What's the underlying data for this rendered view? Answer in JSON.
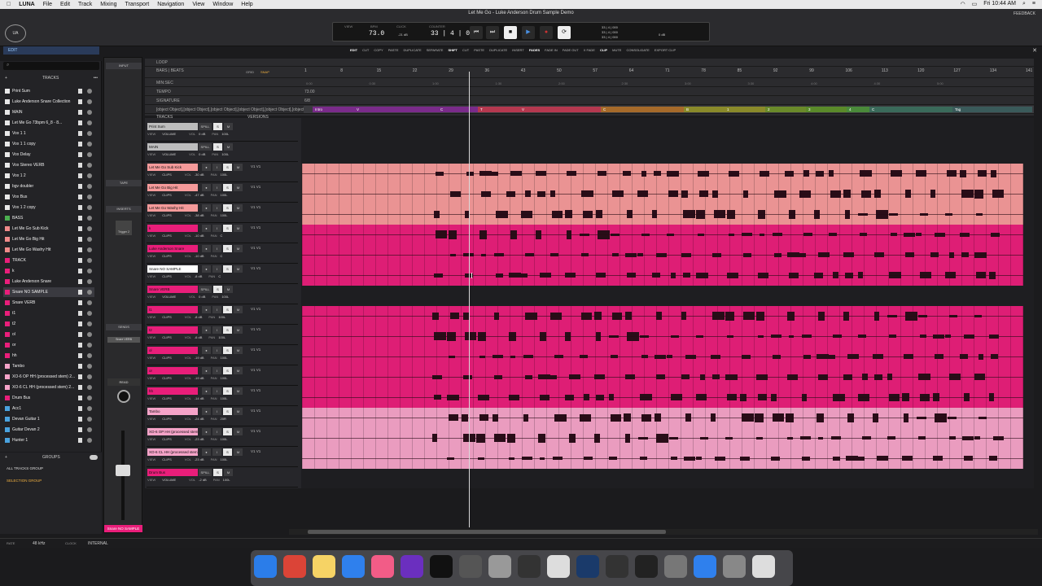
{
  "menubar": {
    "apple": "",
    "app": "LUNA",
    "items": [
      "File",
      "Edit",
      "Track",
      "Mixing",
      "Transport",
      "Navigation",
      "View",
      "Window",
      "Help"
    ],
    "time": "Fri 10:44 AM"
  },
  "window": {
    "title": "Let Me Go - Luke Anderson Drum Sample Demo",
    "feedback": "FEEDBACK"
  },
  "transport": {
    "tempo": "73.0",
    "counter": "33 | 4 | 000",
    "click_vol": "-21 dB",
    "bpm_label": "BPM",
    "click_label": "CLICK",
    "counter_label": "COUNTER",
    "view_label": "VIEW",
    "monitor": "0 dB",
    "pos1": "33 | 4 | 000",
    "pos2": "33 | 4 | 000",
    "pos3": "33 | 4 | 000"
  },
  "editbar": {
    "items": [
      "EDIT",
      "CUT",
      "COPY",
      "PASTE",
      "DUPLICATE",
      "SEPARATE",
      "SHIFT",
      "CUT",
      "PASTE",
      "DUPLICATE",
      "INSERT",
      "FADES",
      "FADE IN",
      "FADE OUT",
      "X FADE",
      "CLIP",
      "MUTE",
      "CONSOLIDATE",
      "EXPORT CLIP"
    ]
  },
  "sidebar": {
    "tab": "EDIT",
    "tracks_title": "TRACKS",
    "groups_title": "GROUPS",
    "groups": [
      "ALL TRACKS GROUP",
      "SELECTION GROUP"
    ],
    "tracks": [
      {
        "name": "Print Sum",
        "color": "#e8e8e8"
      },
      {
        "name": "Luke Anderson Snare Collection",
        "color": "#e8e8e8"
      },
      {
        "name": "MAIN",
        "color": "#e8e8e8"
      },
      {
        "name": "Let Me Go 73bpm 6_8 - 8...",
        "color": "#e8e8e8"
      },
      {
        "name": "Vox 1 1",
        "color": "#e8e8e8"
      },
      {
        "name": "Vox 1 1 copy",
        "color": "#e8e8e8"
      },
      {
        "name": "Vox Delay",
        "color": "#e8e8e8"
      },
      {
        "name": "Vox Stereo VERB",
        "color": "#e8e8e8"
      },
      {
        "name": "Vox 1 2",
        "color": "#e8e8e8"
      },
      {
        "name": "bgv doubler",
        "color": "#e8e8e8"
      },
      {
        "name": "Vox Bus",
        "color": "#e8e8e8"
      },
      {
        "name": "Vox 1 2 copy",
        "color": "#e8e8e8"
      },
      {
        "name": "BASS",
        "color": "#4caf50"
      },
      {
        "name": "Let Me Go Sub Kick",
        "color": "#f08a8a"
      },
      {
        "name": "Let Me Go Big Hit",
        "color": "#f08a8a"
      },
      {
        "name": "Let Me Go Washy Hit",
        "color": "#f08a8a"
      },
      {
        "name": "TRACK",
        "color": "#e91e7a"
      },
      {
        "name": "k",
        "color": "#e91e7a"
      },
      {
        "name": "Luke Anderson Snare",
        "color": "#e91e7a"
      },
      {
        "name": "Snare NO SAMPLE",
        "color": "#e91e7a"
      },
      {
        "name": "Snare VERB",
        "color": "#e91e7a"
      },
      {
        "name": "t1",
        "color": "#e91e7a"
      },
      {
        "name": "t2",
        "color": "#e91e7a"
      },
      {
        "name": "ol",
        "color": "#e91e7a"
      },
      {
        "name": "or",
        "color": "#e91e7a"
      },
      {
        "name": "hh",
        "color": "#e91e7a"
      },
      {
        "name": "Tambo",
        "color": "#f5a3c8"
      },
      {
        "name": "XO-6 OP HH (processed stem) 2...",
        "color": "#f5a3c8"
      },
      {
        "name": "XO-6 CL HH (processed stem) 2...",
        "color": "#f5a3c8"
      },
      {
        "name": "Drum Bus",
        "color": "#e91e7a"
      },
      {
        "name": "Acc1",
        "color": "#4aa3df"
      },
      {
        "name": "Devan Guitar 1",
        "color": "#4aa3df"
      },
      {
        "name": "Guitar Devan 2",
        "color": "#4aa3df"
      },
      {
        "name": "Hunter 1",
        "color": "#4aa3df"
      }
    ]
  },
  "channel": {
    "input": "INPUT",
    "tape": "TAPE",
    "inserts": "INSERTS",
    "sends": "SENDS",
    "send1": "Snare VERB",
    "read": "READ",
    "name": "Snare NO SAMPLE",
    "insert1": "Trigger 2"
  },
  "rulers": {
    "loop": "LOOP",
    "bars": "BARS | BEATS",
    "minsec": "MIN:SEC",
    "tempo": "TEMPO",
    "tempo_val": "73.00",
    "signature": "SIGNATURE",
    "sig_val": "6/8",
    "markers": [
      {
        "label": "Intro",
        "color": "#7a2b8a"
      },
      {
        "label": "V",
        "color": "#7a2b8a"
      },
      {
        "label": "C",
        "color": "#7a2b8a"
      },
      {
        "label": "T",
        "color": "#b5384f"
      },
      {
        "label": "V",
        "color": "#b5384f"
      },
      {
        "label": "C",
        "color": "#a66a2a"
      },
      {
        "label": "B",
        "color": "#8a8a2a"
      },
      {
        "label": "1",
        "color": "#8a8a2a"
      },
      {
        "label": "2",
        "color": "#6a8a2a"
      },
      {
        "label": "3",
        "color": "#5a8a2a"
      },
      {
        "label": "4",
        "color": "#4a8a3a"
      },
      {
        "label": "C",
        "color": "#3a6a5a"
      },
      {
        "label": "Tag",
        "color": "#3a5a5a"
      }
    ],
    "tracks": "TRACKS",
    "versions": "VERSIONS",
    "grid": "GRID",
    "snap": "SNAP",
    "bar_numbers": [
      "1",
      "8",
      "15",
      "22",
      "29",
      "36",
      "43",
      "50",
      "57",
      "64",
      "71",
      "78",
      "85",
      "92",
      "99",
      "106",
      "113",
      "120",
      "127",
      "134",
      "141"
    ],
    "time_numbers": [
      "0:00",
      "0:30",
      "1:00",
      "1:30",
      "2:00",
      "2:30",
      "3:00",
      "3:30",
      "4:00",
      "4:30",
      "5:00"
    ]
  },
  "headers": [
    {
      "name": "Print Sum",
      "type": "VOLUME",
      "vol": "0 dB",
      "pan": "100L",
      "color": "#bdbdbd",
      "spill": "SPILL"
    },
    {
      "name": "MAIN",
      "type": "VOLUME",
      "vol": "0 dB",
      "pan": "100L",
      "color": "#bdbdbd",
      "spill": "SPILL"
    },
    {
      "name": "Let Me Go Sub Kick",
      "type": "CLIPS",
      "vol": "-30 dB",
      "pan": "100L",
      "color": "#f59a9a"
    },
    {
      "name": "Let Me Go Big Hit",
      "type": "CLIPS",
      "vol": "-47 dB",
      "pan": "100L",
      "color": "#f59a9a"
    },
    {
      "name": "Let Me Go Washy Hit",
      "type": "CLIPS",
      "vol": "-38 dB",
      "pan": "100L",
      "color": "#f59a9a"
    },
    {
      "name": "k",
      "type": "CLIPS",
      "vol": "-10 dB",
      "pan": "C",
      "color": "#e91e7a"
    },
    {
      "name": "Luke Anderson Snare",
      "type": "CLIPS",
      "vol": "-10 dB",
      "pan": "C",
      "color": "#e91e7a"
    },
    {
      "name": "Snare NO SAMPLE",
      "type": "CLIPS",
      "vol": "-8 dB",
      "pan": "C",
      "color": "#ffffff"
    },
    {
      "name": "Snare VERB",
      "type": "VOLUME",
      "vol": "0 dB",
      "pan": "100L",
      "color": "#e91e7a",
      "spill": "SPILL"
    },
    {
      "name": "t1",
      "type": "CLIPS",
      "vol": "-8 dB",
      "pan": "100L",
      "color": "#e91e7a"
    },
    {
      "name": "t2",
      "type": "CLIPS",
      "vol": "-6 dB",
      "pan": "100L",
      "color": "#e91e7a"
    },
    {
      "name": "ol",
      "type": "CLIPS",
      "vol": "-19 dB",
      "pan": "100L",
      "color": "#e91e7a"
    },
    {
      "name": "or",
      "type": "CLIPS",
      "vol": "-19 dB",
      "pan": "100L",
      "color": "#e91e7a"
    },
    {
      "name": "hh",
      "type": "CLIPS",
      "vol": "-14 dB",
      "pan": "100L",
      "color": "#e91e7a"
    },
    {
      "name": "Tambo",
      "type": "CLIPS",
      "vol": "-24 dB",
      "pan": "20R",
      "color": "#f5a3c8"
    },
    {
      "name": "XO-6 OP HH (processed stem) 2...",
      "type": "CLIPS",
      "vol": "-23 dB",
      "pan": "100L",
      "color": "#f5a3c8"
    },
    {
      "name": "XO-6 CL HH (processed stem) 2...",
      "type": "CLIPS",
      "vol": "-23 dB",
      "pan": "100L",
      "color": "#f5a3c8"
    },
    {
      "name": "Drum Bus",
      "type": "VOLUME",
      "vol": "-2 dB",
      "pan": "100L",
      "color": "#e91e7a",
      "spill": "SPILL"
    }
  ],
  "status": {
    "rate_label": "RATE",
    "rate": "48 kHz",
    "clock_label": "CLOCK",
    "clock": "INTERNAL"
  },
  "colors": {
    "accent_pink": "#e91e7a",
    "light_pink": "#f5a3c8",
    "salmon": "#f59a9a",
    "edit_blue": "#2a3b5a"
  }
}
